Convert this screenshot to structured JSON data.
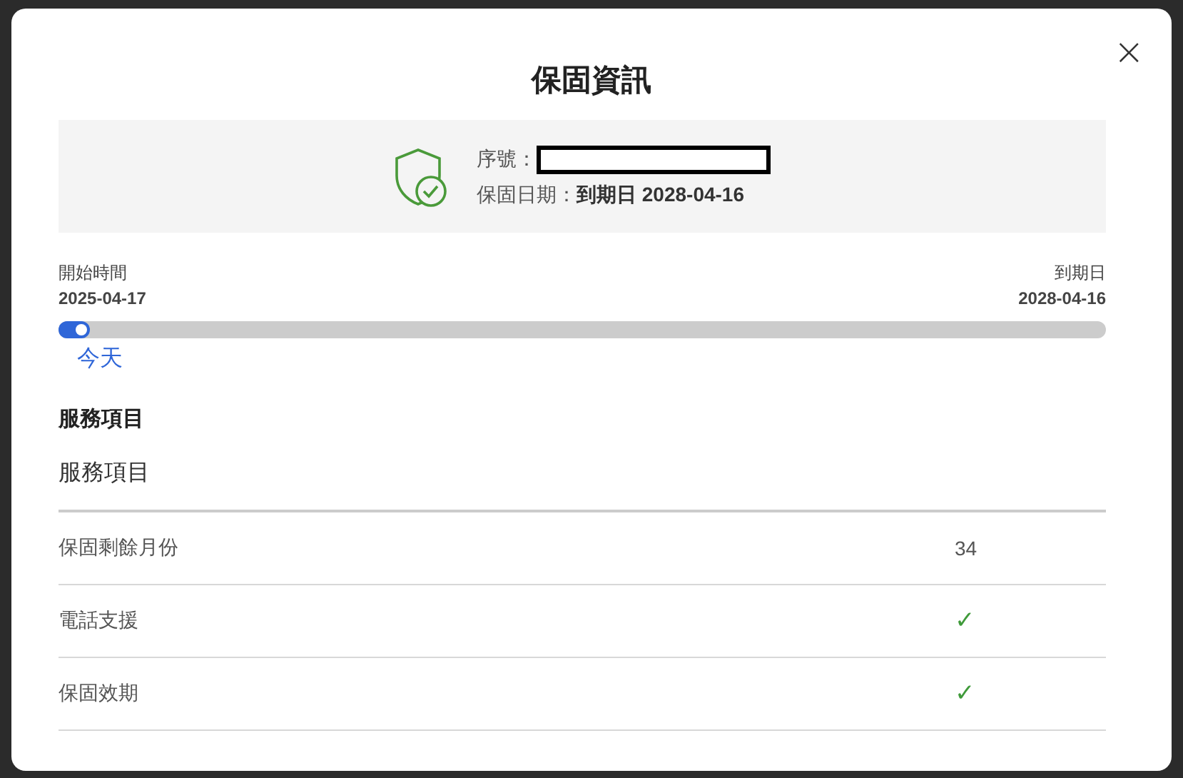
{
  "dialog": {
    "title": "保固資訊",
    "close": "×"
  },
  "summary": {
    "serial_label": "序號：",
    "date_label": "保固日期：",
    "date_value": "到期日 2028-04-16"
  },
  "timeline": {
    "start_label": "開始時間",
    "start_date": "2025-04-17",
    "end_label": "到期日",
    "end_date": "2028-04-16",
    "level": 0.03,
    "today": "今天"
  },
  "services": {
    "heading": "服務項目",
    "column_header": "服務項目",
    "rows": [
      {
        "label": "保固剩餘月份",
        "kind": "text",
        "value": "34"
      },
      {
        "label": "電話支援",
        "kind": "check",
        "value": "✓"
      },
      {
        "label": "保固效期",
        "kind": "check",
        "value": "✓"
      }
    ]
  }
}
